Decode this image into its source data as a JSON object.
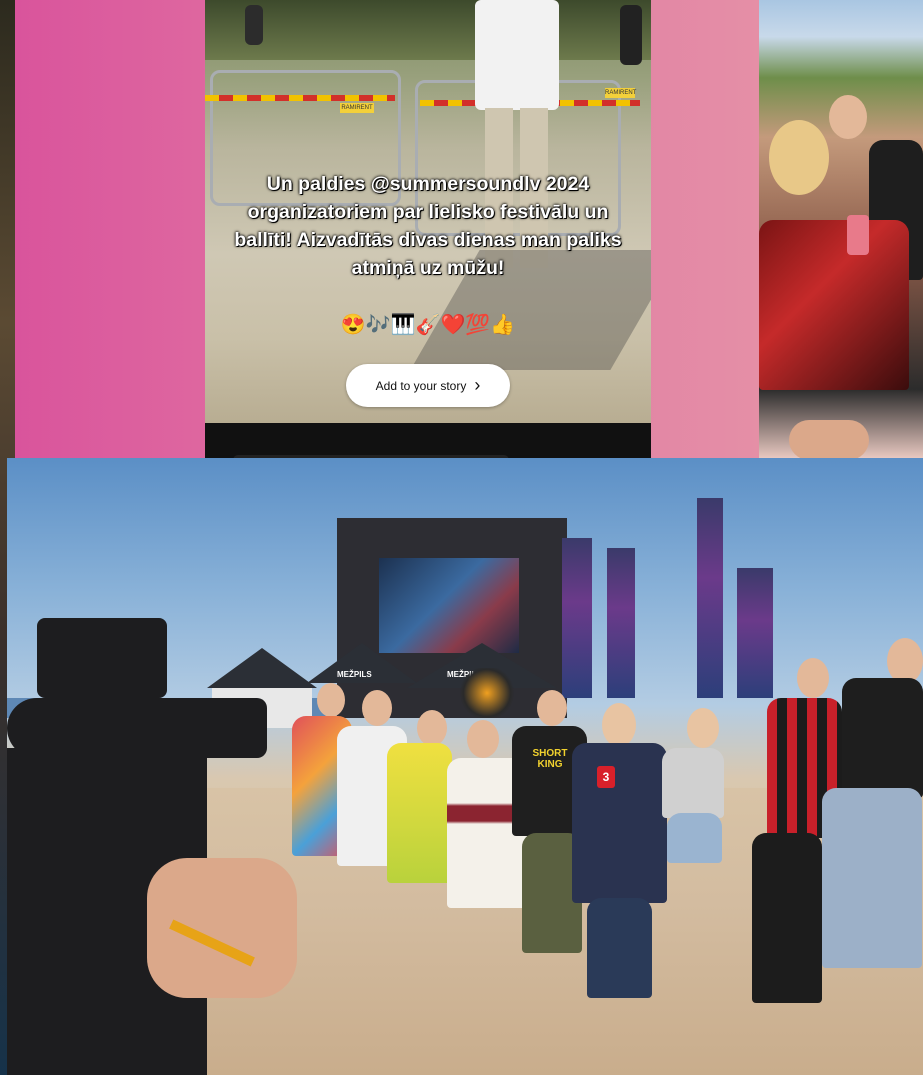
{
  "story": {
    "caption": "Un paldies @summersoundlv 2024 organizatoriem par lielisko festivālu un ballīti! Aizvadītās divas dienas man paliks atmiņā uz mūžu!",
    "emoji": "😍🎶🎹🎸❤️💯👍",
    "add_to_story_label": "Add to your story",
    "barrier_sign": "RAMIRENT"
  },
  "beach_photo": {
    "shirt_text": "SHORT KING",
    "tent_text": "MEŽPILS",
    "mic_logo": "3"
  },
  "colors": {
    "story_background": "#e07fa4",
    "button_background": "#ffffff",
    "caption_text": "#ffffff"
  }
}
